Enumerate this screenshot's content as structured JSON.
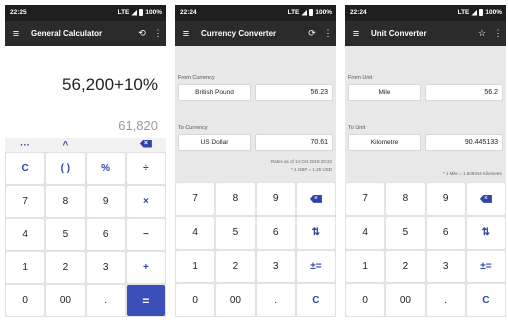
{
  "screens": [
    {
      "status": {
        "time": "22:25",
        "signal": "LTE",
        "battery": "100%"
      },
      "appbar": {
        "title": "General Calculator",
        "menu_icon": "≡",
        "history_icon": "⟲",
        "more_icon": "⋮"
      },
      "display": {
        "expression": "56,200+10%",
        "result": "61,820"
      },
      "strip": [
        "···",
        "^",
        "⌫"
      ],
      "keys": [
        [
          "C",
          "( )",
          "%",
          "÷"
        ],
        [
          "7",
          "8",
          "9",
          "×"
        ],
        [
          "4",
          "5",
          "6",
          "−"
        ],
        [
          "1",
          "2",
          "3",
          "+"
        ],
        [
          "0",
          "00",
          ".",
          "="
        ]
      ]
    },
    {
      "status": {
        "time": "22:24",
        "signal": "LTE",
        "battery": "100%"
      },
      "appbar": {
        "title": "Currency Converter",
        "menu_icon": "≡",
        "refresh_icon": "⟳",
        "more_icon": "⋮"
      },
      "from_label": "From Currency",
      "from_unit": "British Pound",
      "from_value": "56.23",
      "to_label": "To Currency",
      "to_unit": "US Dollar",
      "to_value": "70.61",
      "note1": "Rates as of 14 Oct 2019 20:22",
      "note2": "* 1 GBP = 1.26 USD",
      "keys": [
        [
          "7",
          "8",
          "9",
          "⌫"
        ],
        [
          "4",
          "5",
          "6",
          "⇅"
        ],
        [
          "1",
          "2",
          "3",
          "±="
        ],
        [
          "0",
          "00",
          ".",
          "C"
        ]
      ]
    },
    {
      "status": {
        "time": "22:24",
        "signal": "LTE",
        "battery": "100%"
      },
      "appbar": {
        "title": "Unit Converter",
        "menu_icon": "≡",
        "star_icon": "☆",
        "more_icon": "⋮"
      },
      "from_label": "From Unit",
      "from_unit": "Mile",
      "from_value": "56.2",
      "to_label": "To Unit",
      "to_unit": "Kilometre",
      "to_value": "90.445133",
      "note1": "* 1 Mile = 1.609344 Kilometre",
      "keys": [
        [
          "7",
          "8",
          "9",
          "⌫"
        ],
        [
          "4",
          "5",
          "6",
          "⇅"
        ],
        [
          "1",
          "2",
          "3",
          "±="
        ],
        [
          "0",
          "00",
          ".",
          "C"
        ]
      ]
    }
  ]
}
